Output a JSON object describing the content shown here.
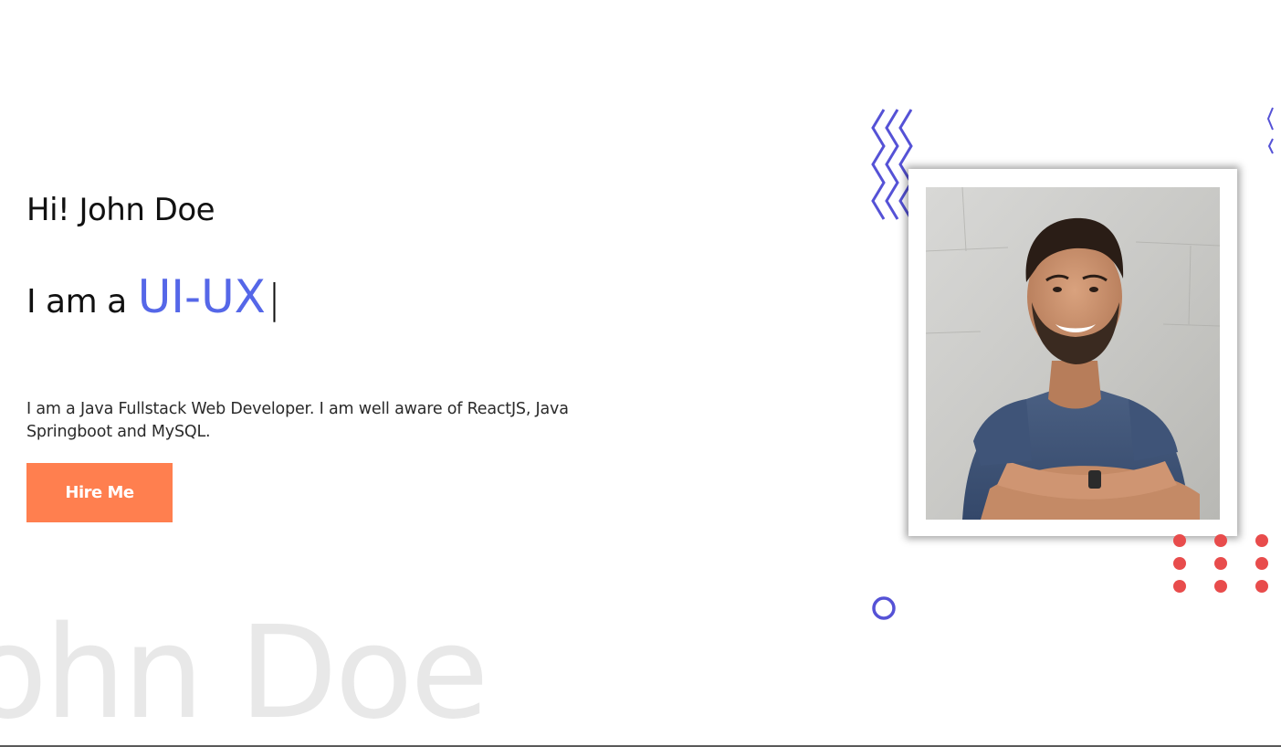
{
  "hero": {
    "greeting": "Hi! John Doe",
    "role_prefix": "I am a",
    "role_value": "UI-UX",
    "caret": "|",
    "bio": "I am a Java Fullstack Web Developer. I am well aware of ReactJS, Java Springboot and MySQL.",
    "hire_button_label": "Hire Me",
    "watermark_text": "John Doe"
  },
  "decorations": {
    "zigzag_icon": "zigzag-lines-icon",
    "dots_icon": "dot-grid-icon",
    "ring_icon": "circle-outline-icon"
  },
  "photo": {
    "alt": "portrait-photo"
  },
  "colors": {
    "accent": "#5567e8",
    "button": "#ff7f4f",
    "zigzag": "#5552d6",
    "dots": "#e84c4c",
    "ring": "#5552d6",
    "watermark": "#e8e8e8"
  }
}
